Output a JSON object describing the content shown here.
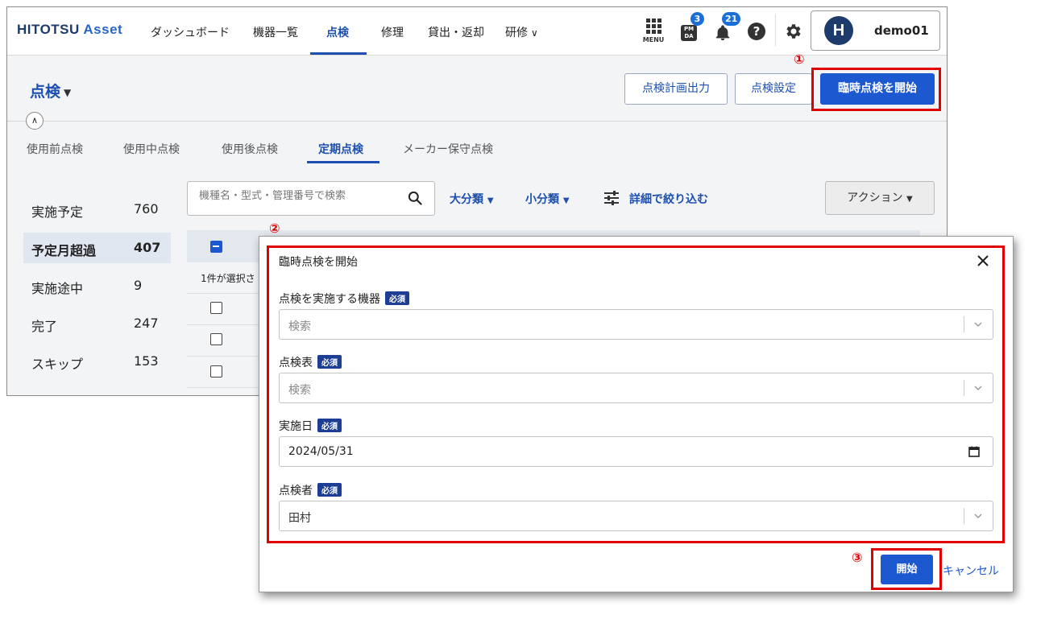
{
  "header": {
    "logo_main": "HITOTSU ",
    "logo_accent": "Asset",
    "nav": [
      {
        "label": "ダッシュボード"
      },
      {
        "label": "機器一覧"
      },
      {
        "label": "点検"
      },
      {
        "label": "修理"
      },
      {
        "label": "貸出・返却"
      },
      {
        "label": "研修"
      }
    ],
    "menu_label": "MENU",
    "pmda_label_1": "PM",
    "pmda_label_2": "DA",
    "pmda_badge": "3",
    "notification_badge": "21",
    "help_label": "?",
    "avatar_letter": "H",
    "user_name": "demo01"
  },
  "page": {
    "title": "点検",
    "buttons": {
      "plan_output": "点検計画出力",
      "settings": "点検設定",
      "start_adhoc": "臨時点検を開始"
    },
    "tabs": [
      {
        "label": "使用前点検"
      },
      {
        "label": "使用中点検"
      },
      {
        "label": "使用後点検"
      },
      {
        "label": "定期点検"
      },
      {
        "label": "メーカー保守点検"
      }
    ],
    "sidebar": [
      {
        "label": "実施予定",
        "count": "760"
      },
      {
        "label": "予定月超過",
        "count": "407"
      },
      {
        "label": "実施途中",
        "count": "9"
      },
      {
        "label": "完了",
        "count": "247"
      },
      {
        "label": "スキップ",
        "count": "153"
      }
    ],
    "search_placeholder": "機種名・型式・管理番号で検索",
    "filters": {
      "major": "大分類",
      "minor": "小分類",
      "detail": "詳細で絞り込む"
    },
    "action_label": "アクション",
    "selected_count": "1件が選択さ"
  },
  "annotations": {
    "m1": "①",
    "m2": "②",
    "m3": "③"
  },
  "modal": {
    "title": "臨時点検を開始",
    "required_label": "必須",
    "fields": {
      "device": {
        "label": "点検を実施する機器",
        "placeholder": "検索"
      },
      "sheet": {
        "label": "点検表",
        "placeholder": "検索"
      },
      "date": {
        "label": "実施日",
        "value": "2024/05/31"
      },
      "inspector": {
        "label": "点検者",
        "value": "田村"
      }
    },
    "start_label": "開始",
    "cancel_label": "キャンセル"
  },
  "colors": {
    "primary": "#1c58d0",
    "brand_dark": "#1d3b6b",
    "annotation_red": "#e00000",
    "required_badge": "#1c3f95"
  }
}
